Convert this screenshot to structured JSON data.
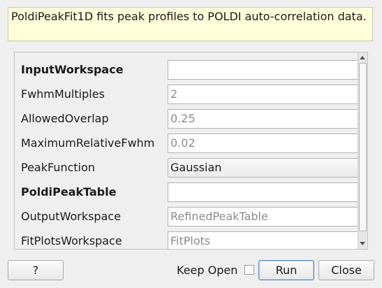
{
  "description": "PoldiPeakFit1D fits peak profiles to POLDI auto-correlation data.",
  "properties": [
    {
      "label": "InputWorkspace",
      "bold": true,
      "type": "text",
      "value": ""
    },
    {
      "label": "FwhmMultiples",
      "bold": false,
      "type": "text",
      "value": "2"
    },
    {
      "label": "AllowedOverlap",
      "bold": false,
      "type": "text",
      "value": "0.25"
    },
    {
      "label": "MaximumRelativeFwhm",
      "bold": false,
      "type": "text",
      "value": "0.02"
    },
    {
      "label": "PeakFunction",
      "bold": false,
      "type": "combo",
      "value": "Gaussian"
    },
    {
      "label": "PoldiPeakTable",
      "bold": true,
      "type": "text",
      "value": ""
    },
    {
      "label": "OutputWorkspace",
      "bold": false,
      "type": "text",
      "value": "RefinedPeakTable"
    },
    {
      "label": "FitPlotsWorkspace",
      "bold": false,
      "type": "text",
      "value": "FitPlots"
    }
  ],
  "buttons": {
    "help": "?",
    "keep_open": "Keep Open",
    "run": "Run",
    "close": "Close"
  },
  "keep_open_checked": false
}
